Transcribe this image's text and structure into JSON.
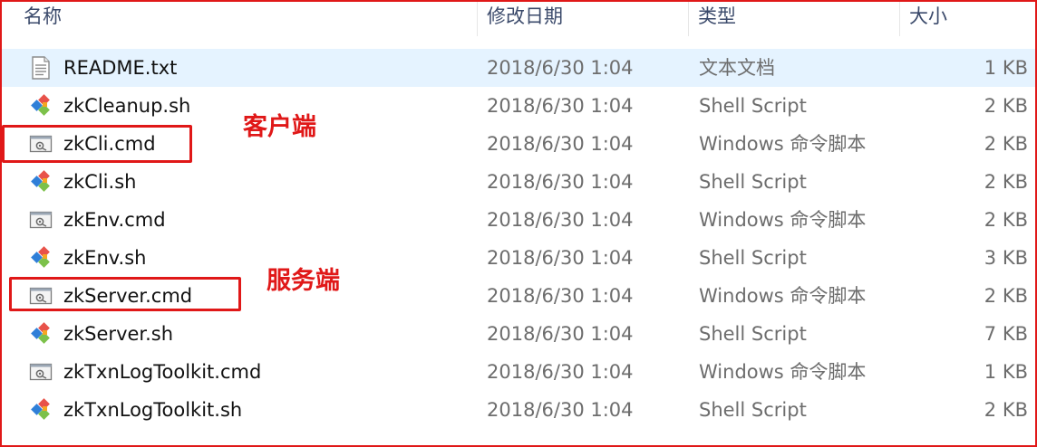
{
  "header": {
    "name": "名称",
    "date": "修改日期",
    "type": "类型",
    "size": "大小"
  },
  "files": [
    {
      "name": "README.txt",
      "date": "2018/6/30 1:04",
      "type": "文本文档",
      "size": "1 KB",
      "icon": "text-file-icon"
    },
    {
      "name": "zkCleanup.sh",
      "date": "2018/6/30 1:04",
      "type": "Shell Script",
      "size": "2 KB",
      "icon": "git-script-icon"
    },
    {
      "name": "zkCli.cmd",
      "date": "2018/6/30 1:04",
      "type": "Windows 命令脚本",
      "size": "2 KB",
      "icon": "cmd-script-icon"
    },
    {
      "name": "zkCli.sh",
      "date": "2018/6/30 1:04",
      "type": "Shell Script",
      "size": "2 KB",
      "icon": "git-script-icon"
    },
    {
      "name": "zkEnv.cmd",
      "date": "2018/6/30 1:04",
      "type": "Windows 命令脚本",
      "size": "2 KB",
      "icon": "cmd-script-icon"
    },
    {
      "name": "zkEnv.sh",
      "date": "2018/6/30 1:04",
      "type": "Shell Script",
      "size": "3 KB",
      "icon": "git-script-icon"
    },
    {
      "name": "zkServer.cmd",
      "date": "2018/6/30 1:04",
      "type": "Windows 命令脚本",
      "size": "2 KB",
      "icon": "cmd-script-icon"
    },
    {
      "name": "zkServer.sh",
      "date": "2018/6/30 1:04",
      "type": "Shell Script",
      "size": "7 KB",
      "icon": "git-script-icon"
    },
    {
      "name": "zkTxnLogToolkit.cmd",
      "date": "2018/6/30 1:04",
      "type": "Windows 命令脚本",
      "size": "1 KB",
      "icon": "cmd-script-icon"
    },
    {
      "name": "zkTxnLogToolkit.sh",
      "date": "2018/6/30 1:04",
      "type": "Shell Script",
      "size": "2 KB",
      "icon": "git-script-icon"
    }
  ],
  "annotations": {
    "client": "客户端",
    "server": "服务端"
  },
  "colors": {
    "annotation_red": "#e01818",
    "selected_row": "#e5f3ff",
    "header_text": "#3b4a6b"
  }
}
